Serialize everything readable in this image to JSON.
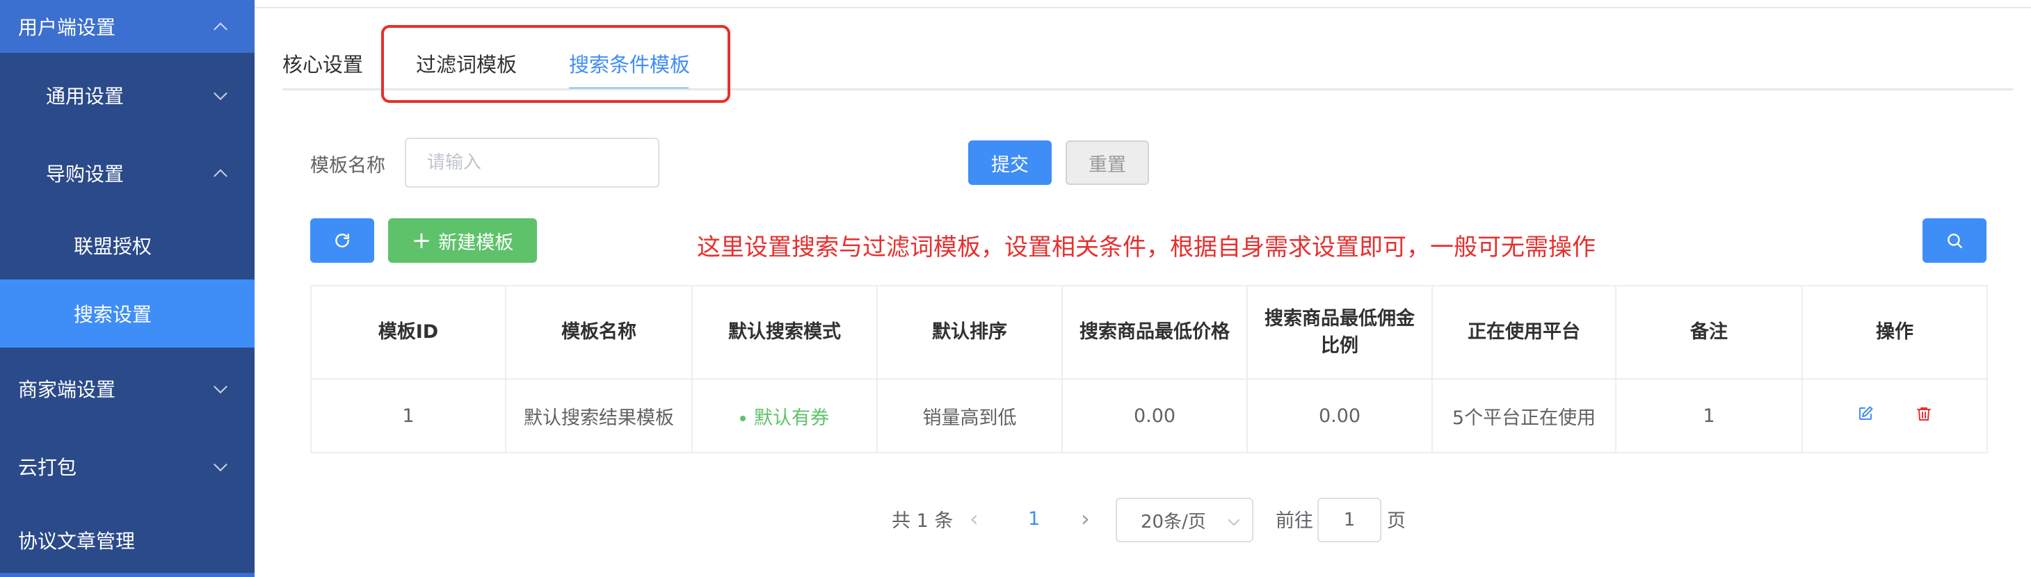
{
  "sidebar": {
    "user_settings": "用户端设置",
    "general_settings": "通用设置",
    "guide_settings": "导购设置",
    "alliance_auth": "联盟授权",
    "search_settings": "搜索设置",
    "merchant_settings": "商家端设置",
    "cloud_package": "云打包",
    "agreement_management": "协议文章管理"
  },
  "tabs": {
    "core": "核心设置",
    "filter_template": "过滤词模板",
    "search_condition_template": "搜索条件模板",
    "active": "搜索条件模板"
  },
  "form": {
    "template_name_label": "模板名称",
    "template_name_placeholder": "请输入",
    "template_name_value": "",
    "submit_label": "提交",
    "reset_label": "重置"
  },
  "toolbar": {
    "refresh_icon": "refresh-icon",
    "new_template_label": "新建模板",
    "search_icon": "search-icon"
  },
  "annotation": "这里设置搜索与过滤词模板，设置相关条件，根据自身需求设置即可，一般可无需操作",
  "table": {
    "columns": [
      "模板ID",
      "模板名称",
      "默认搜索模式",
      "默认排序",
      "搜索商品最低价格",
      "搜索商品最低佣金比例",
      "正在使用平台",
      "备注",
      "操作"
    ],
    "rows": [
      {
        "id": "1",
        "name": "默认搜索结果模板",
        "mode": "默认有券",
        "sort": "销量高到低",
        "min_price": "0.00",
        "min_commission": "0.00",
        "platforms": "5个平台正在使用",
        "remark": "1"
      }
    ]
  },
  "pagination": {
    "total": "共 1 条",
    "current_page": "1",
    "page_size": "20条/页",
    "goto_label": "前往",
    "goto_value": "1",
    "page_unit": "页"
  },
  "colors": {
    "sidebar_bg": "#2a4a8a",
    "sidebar_active": "#3f8ef7",
    "primary": "#3f8ef7",
    "success": "#5ec26a",
    "danger": "#e5302e"
  }
}
